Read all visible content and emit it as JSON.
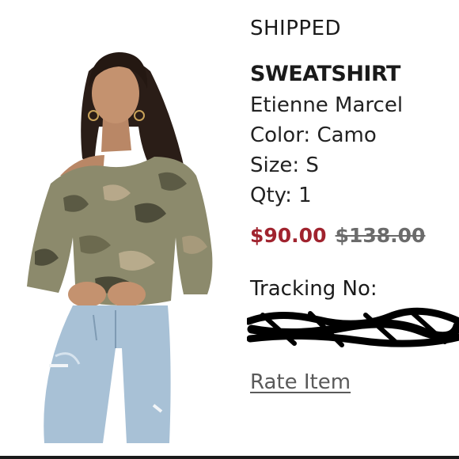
{
  "order": {
    "status": "SHIPPED",
    "product_title": "SWEATSHIRT",
    "brand": "Etienne Marcel",
    "color_line": "Color: Camo",
    "size_line": "Size: S",
    "qty_line": "Qty: 1",
    "sale_price": "$90.00",
    "original_price": "$138.00",
    "tracking_label": "Tracking No:",
    "rate_item_label": "Rate Item"
  },
  "colors": {
    "sale_price": "#a0232e",
    "original_price": "#6b6b6b",
    "text": "#1a1a1a"
  },
  "image": {
    "subject": "model wearing camo off-shoulder sweatshirt and light wash jeans"
  }
}
